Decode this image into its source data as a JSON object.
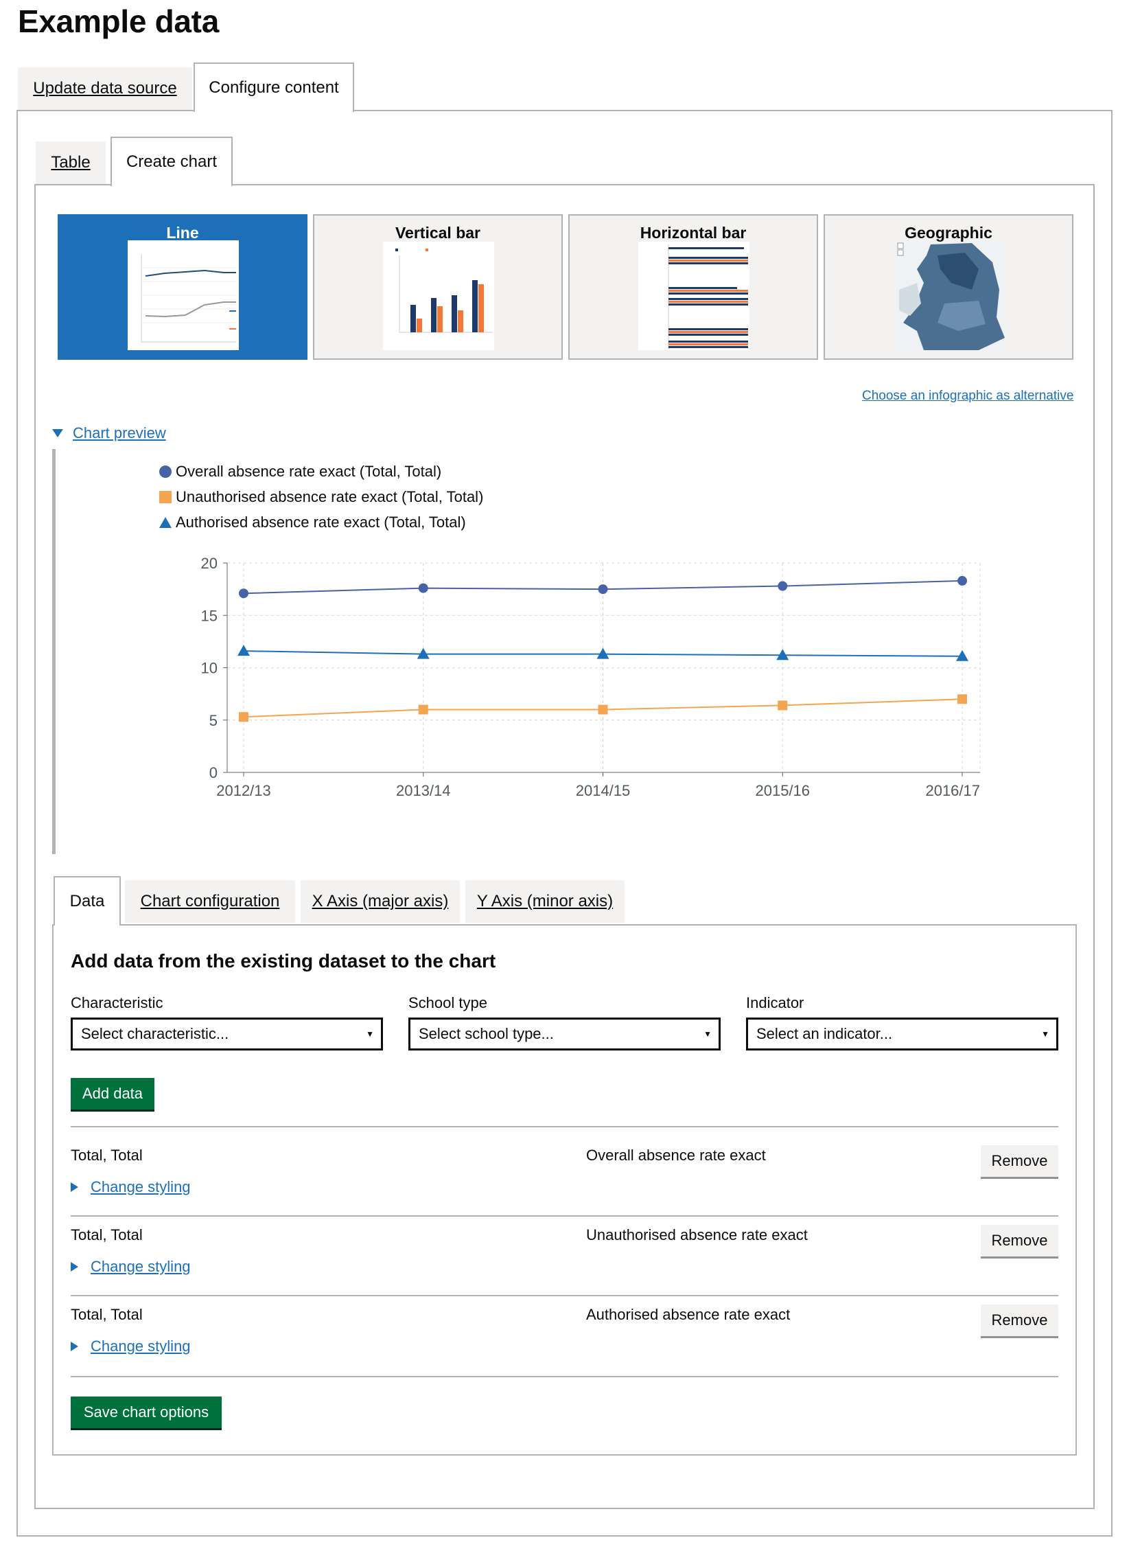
{
  "page": {
    "title": "Example data"
  },
  "top_tabs": [
    {
      "label": "Update data source",
      "active": false
    },
    {
      "label": "Configure content",
      "active": true
    }
  ],
  "sub_tabs": [
    {
      "label": "Table",
      "active": false
    },
    {
      "label": "Create chart",
      "active": true
    }
  ],
  "chart_types": [
    {
      "label": "Line",
      "selected": true
    },
    {
      "label": "Vertical bar",
      "selected": false
    },
    {
      "label": "Horizontal bar",
      "selected": false
    },
    {
      "label": "Geographic",
      "selected": false
    }
  ],
  "infographic_link": "Choose an infographic as alternative",
  "preview": {
    "toggle_label": "Chart preview",
    "expanded": true
  },
  "chart_data": {
    "type": "line",
    "categories": [
      "2012/13",
      "2013/14",
      "2014/15",
      "2015/16",
      "2016/17"
    ],
    "series": [
      {
        "name": "Overall absence rate exact (Total, Total)",
        "values": [
          17.1,
          17.6,
          17.5,
          17.8,
          18.3
        ],
        "color": "#4763a7",
        "marker": "circle"
      },
      {
        "name": "Unauthorised absence rate exact (Total, Total)",
        "values": [
          5.3,
          6.0,
          6.0,
          6.4,
          7.0
        ],
        "color": "#f5a450",
        "marker": "square"
      },
      {
        "name": "Authorised absence rate exact (Total, Total)",
        "values": [
          11.6,
          11.3,
          11.3,
          11.2,
          11.1
        ],
        "color": "#1d70b8",
        "marker": "triangle"
      }
    ],
    "yticks": [
      0,
      5,
      10,
      15,
      20
    ],
    "ylim": [
      0,
      20
    ],
    "grid": true,
    "legend_position": "top-left",
    "title": "",
    "xlabel": "",
    "ylabel": ""
  },
  "config_tabs": [
    {
      "label": "Data",
      "active": true
    },
    {
      "label": "Chart configuration",
      "active": false
    },
    {
      "label": "X Axis (major axis)",
      "active": false
    },
    {
      "label": "Y Axis (minor axis)",
      "active": false
    }
  ],
  "data_form": {
    "heading": "Add data from the existing dataset to the chart",
    "characteristic": {
      "label": "Characteristic",
      "value": "Select characteristic..."
    },
    "school_type": {
      "label": "School type",
      "value": "Select school type..."
    },
    "indicator": {
      "label": "Indicator",
      "value": "Select an indicator..."
    },
    "add_button": "Add data"
  },
  "data_rows": [
    {
      "filter": "Total, Total",
      "indicator": "Overall absence rate exact",
      "styling_link": "Change styling",
      "remove": "Remove"
    },
    {
      "filter": "Total, Total",
      "indicator": "Unauthorised absence rate exact",
      "styling_link": "Change styling",
      "remove": "Remove"
    },
    {
      "filter": "Total, Total",
      "indicator": "Authorised absence rate exact",
      "styling_link": "Change styling",
      "remove": "Remove"
    }
  ],
  "save_button": "Save chart options",
  "colors": {
    "link": "#1d70b8",
    "button_green": "#00703c",
    "border": "#b1b4b6",
    "tab_grey": "#f3f2f1"
  }
}
